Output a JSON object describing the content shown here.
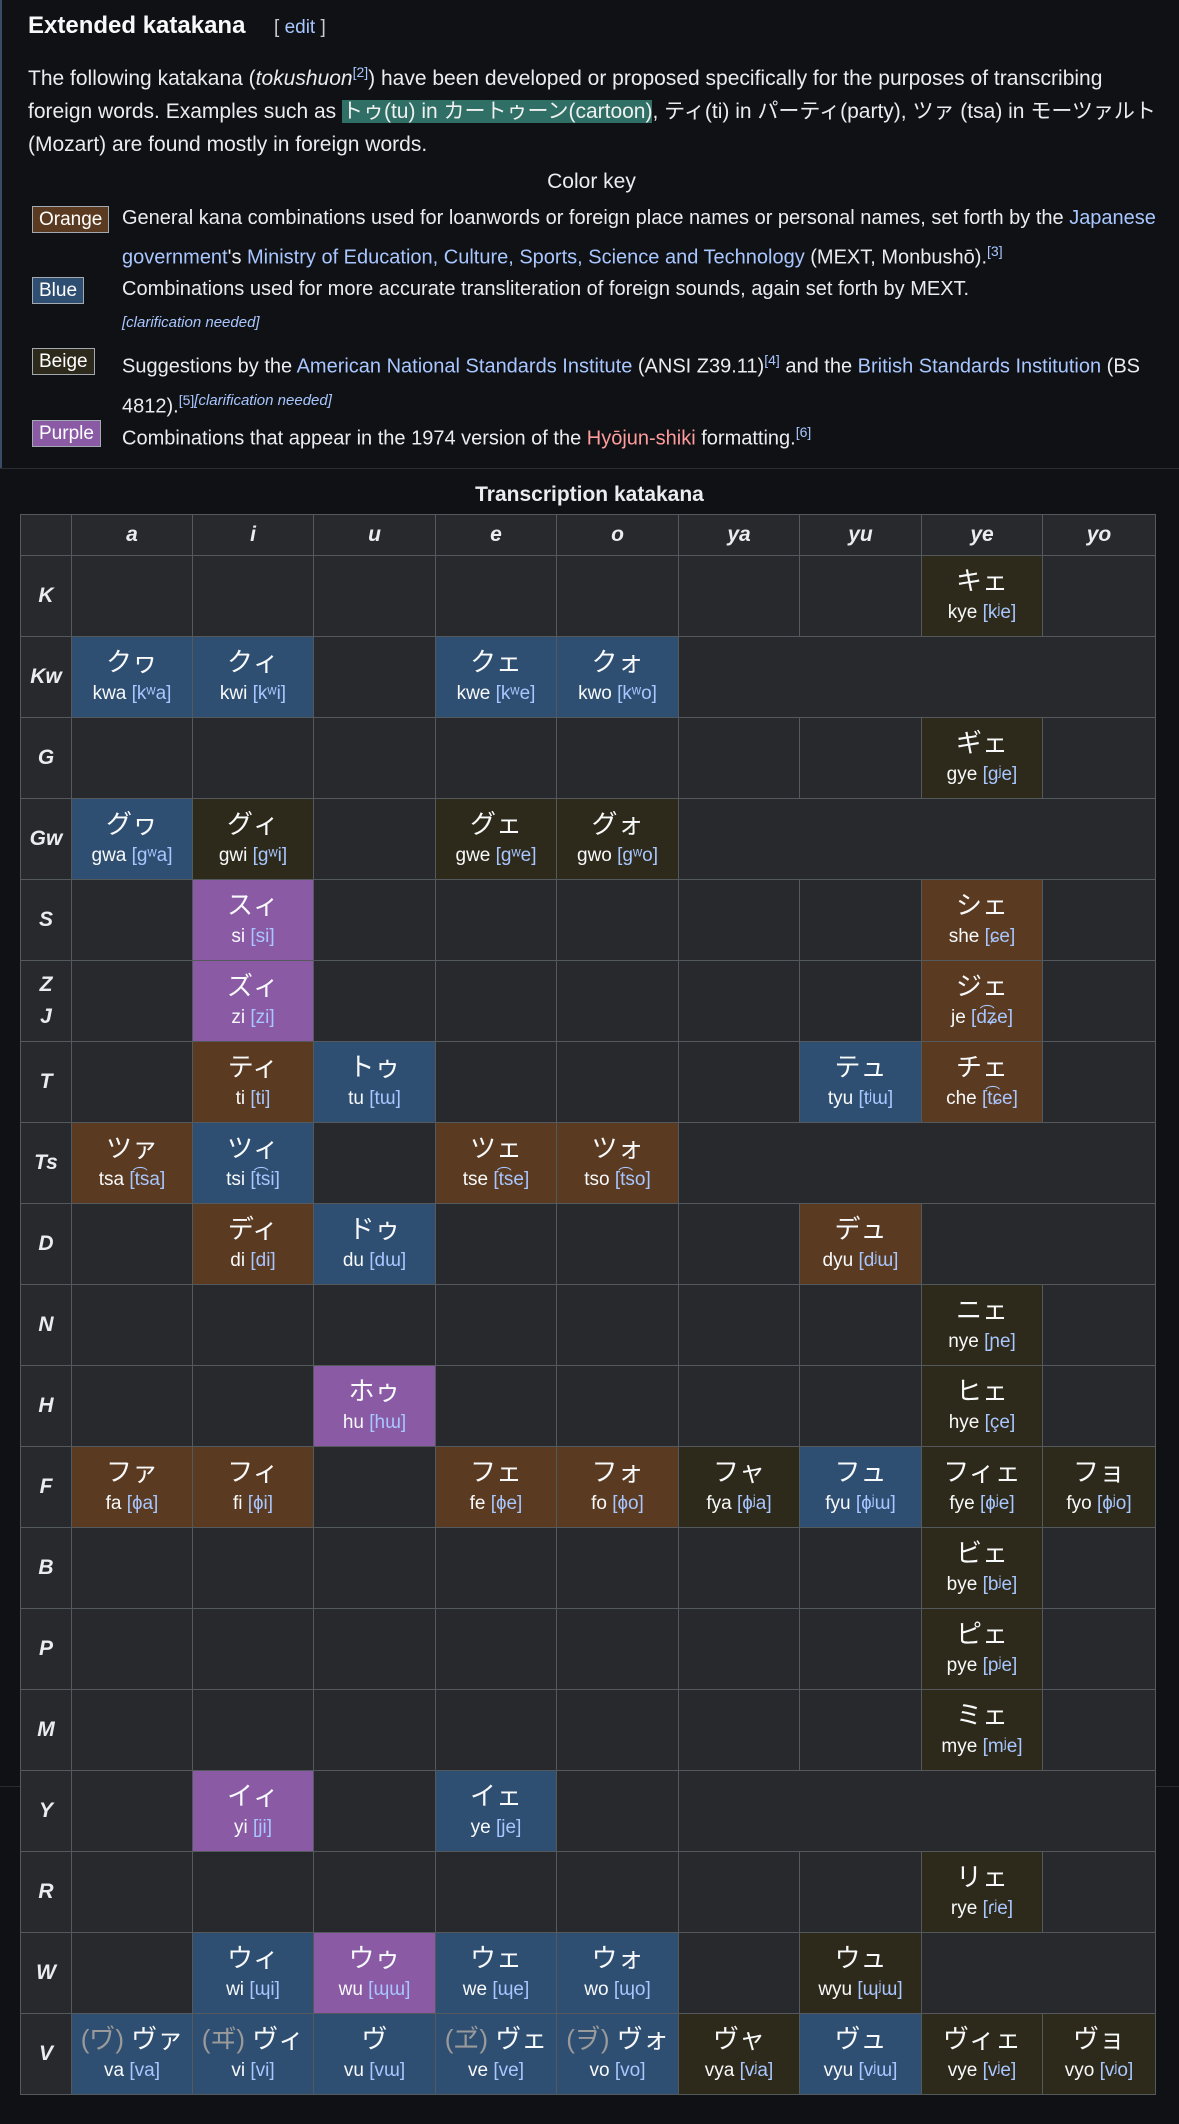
{
  "heading": "Extended katakana",
  "edit": {
    "open": "[ ",
    "label": "edit",
    "close": " ]"
  },
  "intro": {
    "t1": "The following katakana (",
    "term": "tokushuon",
    "ref": "[2]",
    "t2": ") have been developed or proposed specifically for the purposes of transcribing foreign words. Examples such as ",
    "highlight": "トゥ(tu) in カートゥーン(cartoon)",
    "t3": ", ティ(ti) in パーティ(party), ツァ (tsa) in モーツァルト (Mozart) are found mostly in foreign words."
  },
  "color_key": {
    "title": "Color key",
    "orange": {
      "badge": "Orange",
      "t1": "General kana combinations used for loanwords or foreign place names or personal names, set forth by the ",
      "link1": "Japanese government",
      "t2": "'s ",
      "link2": "Ministry of Education, Culture, Sports, Science and Technology",
      "t3": " (MEXT, Monbushō).",
      "ref": "[3]"
    },
    "blue": {
      "badge": "Blue",
      "t1": "Combinations used for more accurate transliteration of foreign sounds, again set forth by MEXT.",
      "cn": "[clarification needed]"
    },
    "beige": {
      "badge": "Beige",
      "t1": "Suggestions by the ",
      "link1": "American National Standards Institute",
      "t2": " (ANSI Z39.11)",
      "ref1": "[4]",
      "t3": " and the ",
      "link2": "British Standards Institution",
      "t4": " (BS 4812).",
      "ref2": "[5]",
      "cn": "[clarification needed]"
    },
    "purple": {
      "badge": "Purple",
      "t1": "Combinations that appear in the 1974 version of the ",
      "link1": "Hyōjun-shiki",
      "t2": " formatting.",
      "ref": "[6]"
    },
    "colors": {
      "orange": "#5a3a20",
      "blue": "#2e4f72",
      "beige": "#2e2a1b",
      "purple": "#8a5aa5"
    }
  },
  "table": {
    "caption": "Transcription katakana",
    "columns": [
      "a",
      "i",
      "u",
      "e",
      "o",
      "ya",
      "yu",
      "ye",
      "yo"
    ],
    "rows": [
      {
        "head": "K",
        "cells": [
          {
            "color": "empty"
          },
          {
            "color": "empty"
          },
          {
            "color": "empty"
          },
          {
            "color": "empty"
          },
          {
            "color": "empty"
          },
          {
            "color": "empty"
          },
          {
            "color": "empty"
          },
          {
            "color": "y",
            "kana": "キェ",
            "rom": "kye",
            "ipa": "[kʲe]"
          },
          {
            "color": "empty"
          }
        ]
      },
      {
        "head": "Kw",
        "cells": [
          {
            "color": "b",
            "kana": "クヮ",
            "rom": "kwa",
            "ipa": "[kʷa]"
          },
          {
            "color": "b",
            "kana": "クィ",
            "rom": "kwi",
            "ipa": "[kʷi]"
          },
          {
            "color": "empty"
          },
          {
            "color": "b",
            "kana": "クェ",
            "rom": "kwe",
            "ipa": "[kʷe]"
          },
          {
            "color": "b",
            "kana": "クォ",
            "rom": "kwo",
            "ipa": "[kʷo]"
          },
          {
            "color": "empty",
            "span": 4
          }
        ]
      },
      {
        "head": "G",
        "cells": [
          {
            "color": "empty"
          },
          {
            "color": "empty"
          },
          {
            "color": "empty"
          },
          {
            "color": "empty"
          },
          {
            "color": "empty"
          },
          {
            "color": "empty"
          },
          {
            "color": "empty"
          },
          {
            "color": "y",
            "kana": "ギェ",
            "rom": "gye",
            "ipa": "[ɡʲe]"
          },
          {
            "color": "empty"
          }
        ]
      },
      {
        "head": "Gw",
        "cells": [
          {
            "color": "b",
            "kana": "グヮ",
            "rom": "gwa",
            "ipa": "[ɡʷa]"
          },
          {
            "color": "y",
            "kana": "グィ",
            "rom": "gwi",
            "ipa": "[ɡʷi]"
          },
          {
            "color": "empty"
          },
          {
            "color": "y",
            "kana": "グェ",
            "rom": "gwe",
            "ipa": "[ɡʷe]"
          },
          {
            "color": "y",
            "kana": "グォ",
            "rom": "gwo",
            "ipa": "[ɡʷo]"
          },
          {
            "color": "empty",
            "span": 4
          }
        ]
      },
      {
        "head": "S",
        "cells": [
          {
            "color": "empty"
          },
          {
            "color": "p",
            "kana": "スィ",
            "rom": "si",
            "ipa": "[si]"
          },
          {
            "color": "empty"
          },
          {
            "color": "empty"
          },
          {
            "color": "empty"
          },
          {
            "color": "empty"
          },
          {
            "color": "empty"
          },
          {
            "color": "o",
            "kana": "シェ",
            "rom": "she",
            "ipa": "[ɕe]"
          },
          {
            "color": "empty"
          }
        ]
      },
      {
        "head": "Z\nJ",
        "cells": [
          {
            "color": "empty"
          },
          {
            "color": "p",
            "kana": "ズィ",
            "rom": "zi",
            "ipa": "[zi]"
          },
          {
            "color": "empty"
          },
          {
            "color": "empty"
          },
          {
            "color": "empty"
          },
          {
            "color": "empty"
          },
          {
            "color": "empty"
          },
          {
            "color": "o",
            "kana": "ジェ",
            "rom": "je",
            "ipa": "[d͡ʑe]"
          },
          {
            "color": "empty"
          }
        ]
      },
      {
        "head": "T",
        "cells": [
          {
            "color": "empty"
          },
          {
            "color": "o",
            "kana": "ティ",
            "rom": "ti",
            "ipa": "[ti]"
          },
          {
            "color": "b",
            "kana": "トゥ",
            "rom": "tu",
            "ipa": "[tɯ]"
          },
          {
            "color": "empty"
          },
          {
            "color": "empty"
          },
          {
            "color": "empty"
          },
          {
            "color": "b",
            "kana": "テュ",
            "rom": "tyu",
            "ipa": "[tʲɯ]"
          },
          {
            "color": "o",
            "kana": "チェ",
            "rom": "che",
            "ipa": "[t͡ɕe]"
          },
          {
            "color": "empty"
          }
        ]
      },
      {
        "head": "Ts",
        "cells": [
          {
            "color": "o",
            "kana": "ツァ",
            "rom": "tsa",
            "ipa": "[t͡sa]"
          },
          {
            "color": "b",
            "kana": "ツィ",
            "rom": "tsi",
            "ipa": "[t͡si]"
          },
          {
            "color": "empty"
          },
          {
            "color": "o",
            "kana": "ツェ",
            "rom": "tse",
            "ipa": "[t͡se]"
          },
          {
            "color": "o",
            "kana": "ツォ",
            "rom": "tso",
            "ipa": "[t͡so]"
          },
          {
            "color": "empty",
            "span": 4
          }
        ]
      },
      {
        "head": "D",
        "cells": [
          {
            "color": "empty"
          },
          {
            "color": "o",
            "kana": "ディ",
            "rom": "di",
            "ipa": "[di]"
          },
          {
            "color": "b",
            "kana": "ドゥ",
            "rom": "du",
            "ipa": "[dɯ]"
          },
          {
            "color": "empty"
          },
          {
            "color": "empty"
          },
          {
            "color": "empty"
          },
          {
            "color": "o",
            "kana": "デュ",
            "rom": "dyu",
            "ipa": "[dʲɯ]"
          },
          {
            "color": "empty",
            "span": 2
          }
        ]
      },
      {
        "head": "N",
        "cells": [
          {
            "color": "empty"
          },
          {
            "color": "empty"
          },
          {
            "color": "empty"
          },
          {
            "color": "empty"
          },
          {
            "color": "empty"
          },
          {
            "color": "empty"
          },
          {
            "color": "empty"
          },
          {
            "color": "y",
            "kana": "ニェ",
            "rom": "nye",
            "ipa": "[ɲe]"
          },
          {
            "color": "empty"
          }
        ]
      },
      {
        "head": "H",
        "cells": [
          {
            "color": "empty"
          },
          {
            "color": "empty"
          },
          {
            "color": "p",
            "kana": "ホゥ",
            "rom": "hu",
            "ipa": "[hɯ]"
          },
          {
            "color": "empty"
          },
          {
            "color": "empty"
          },
          {
            "color": "empty"
          },
          {
            "color": "empty"
          },
          {
            "color": "y",
            "kana": "ヒェ",
            "rom": "hye",
            "ipa": "[çe]"
          },
          {
            "color": "empty"
          }
        ]
      },
      {
        "head": "F",
        "cells": [
          {
            "color": "o",
            "kana": "ファ",
            "rom": "fa",
            "ipa": "[ɸa]"
          },
          {
            "color": "o",
            "kana": "フィ",
            "rom": "fi",
            "ipa": "[ɸi]"
          },
          {
            "color": "empty"
          },
          {
            "color": "o",
            "kana": "フェ",
            "rom": "fe",
            "ipa": "[ɸe]"
          },
          {
            "color": "o",
            "kana": "フォ",
            "rom": "fo",
            "ipa": "[ɸo]"
          },
          {
            "color": "y",
            "kana": "フャ",
            "rom": "fya",
            "ipa": "[ɸʲa]"
          },
          {
            "color": "b",
            "kana": "フュ",
            "rom": "fyu",
            "ipa": "[ɸʲɯ]"
          },
          {
            "color": "y",
            "kana": "フィェ",
            "rom": "fye",
            "ipa": "[ɸʲe]"
          },
          {
            "color": "y",
            "kana": "フョ",
            "rom": "fyo",
            "ipa": "[ɸʲo]"
          }
        ]
      },
      {
        "head": "B",
        "cells": [
          {
            "color": "empty"
          },
          {
            "color": "empty"
          },
          {
            "color": "empty"
          },
          {
            "color": "empty"
          },
          {
            "color": "empty"
          },
          {
            "color": "empty"
          },
          {
            "color": "empty"
          },
          {
            "color": "y",
            "kana": "ビェ",
            "rom": "bye",
            "ipa": "[bʲe]"
          },
          {
            "color": "empty"
          }
        ]
      },
      {
        "head": "P",
        "cells": [
          {
            "color": "empty"
          },
          {
            "color": "empty"
          },
          {
            "color": "empty"
          },
          {
            "color": "empty"
          },
          {
            "color": "empty"
          },
          {
            "color": "empty"
          },
          {
            "color": "empty"
          },
          {
            "color": "y",
            "kana": "ピェ",
            "rom": "pye",
            "ipa": "[pʲe]"
          },
          {
            "color": "empty"
          }
        ]
      },
      {
        "head": "M",
        "cells": [
          {
            "color": "empty"
          },
          {
            "color": "empty"
          },
          {
            "color": "empty"
          },
          {
            "color": "empty"
          },
          {
            "color": "empty"
          },
          {
            "color": "empty"
          },
          {
            "color": "empty"
          },
          {
            "color": "y",
            "kana": "ミェ",
            "rom": "mye",
            "ipa": "[mʲe]"
          },
          {
            "color": "empty"
          }
        ]
      },
      {
        "head": "Y",
        "cells": [
          {
            "color": "empty"
          },
          {
            "color": "p",
            "kana": "イィ",
            "rom": "yi",
            "ipa": "[ji]"
          },
          {
            "color": "empty"
          },
          {
            "color": "b",
            "kana": "イェ",
            "rom": "ye",
            "ipa": "[je]"
          },
          {
            "color": "empty"
          },
          {
            "color": "empty",
            "span": 4
          }
        ]
      },
      {
        "head": "R",
        "cells": [
          {
            "color": "empty"
          },
          {
            "color": "empty"
          },
          {
            "color": "empty"
          },
          {
            "color": "empty"
          },
          {
            "color": "empty"
          },
          {
            "color": "empty"
          },
          {
            "color": "empty"
          },
          {
            "color": "y",
            "kana": "リェ",
            "rom": "rye",
            "ipa": "[ɾʲe]"
          },
          {
            "color": "empty"
          }
        ]
      },
      {
        "head": "W",
        "cells": [
          {
            "color": "empty"
          },
          {
            "color": "b",
            "kana": "ウィ",
            "rom": "wi",
            "ipa": "[ɰi]"
          },
          {
            "color": "p",
            "kana": "ウゥ",
            "rom": "wu",
            "ipa": "[ɰɯ]"
          },
          {
            "color": "b",
            "kana": "ウェ",
            "rom": "we",
            "ipa": "[ɰe]"
          },
          {
            "color": "b",
            "kana": "ウォ",
            "rom": "wo",
            "ipa": "[ɰo]"
          },
          {
            "color": "empty"
          },
          {
            "color": "y",
            "kana": "ウュ",
            "rom": "wyu",
            "ipa": "[ɰʲɯ]"
          },
          {
            "color": "empty",
            "span": 2
          }
        ]
      },
      {
        "head": "V",
        "cells": [
          {
            "color": "b",
            "alt": "(ヷ)",
            "kana": "ヴァ",
            "rom": "va",
            "ipa": "[va]"
          },
          {
            "color": "b",
            "alt": "(ヸ)",
            "kana": "ヴィ",
            "rom": "vi",
            "ipa": "[vi]"
          },
          {
            "color": "b",
            "kana": "ヴ",
            "rom": "vu",
            "ipa": "[vɯ]"
          },
          {
            "color": "b",
            "alt": "(ヹ)",
            "kana": "ヴェ",
            "rom": "ve",
            "ipa": "[ve]"
          },
          {
            "color": "b",
            "alt": "(ヺ)",
            "kana": "ヴォ",
            "rom": "vo",
            "ipa": "[vo]"
          },
          {
            "color": "y",
            "kana": "ヴャ",
            "rom": "vya",
            "ipa": "[vʲa]"
          },
          {
            "color": "b",
            "kana": "ヴュ",
            "rom": "vyu",
            "ipa": "[vʲɯ]"
          },
          {
            "color": "y",
            "kana": "ヴィェ",
            "rom": "vye",
            "ipa": "[vʲe]"
          },
          {
            "color": "y",
            "kana": "ヴョ",
            "rom": "vyo",
            "ipa": "[vʲo]"
          }
        ]
      }
    ]
  }
}
